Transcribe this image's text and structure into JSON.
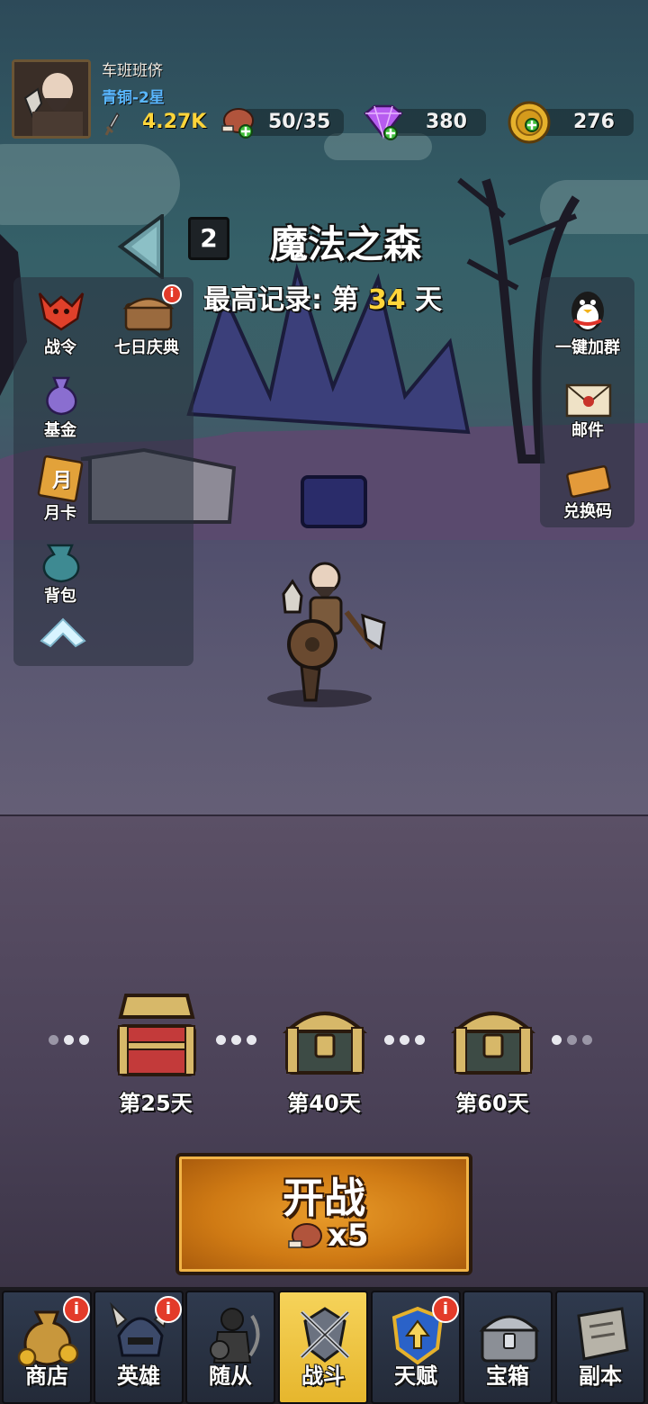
{
  "player": {
    "name": "车班班侪",
    "rank": "青铜-2星"
  },
  "resources": {
    "power": "4.27K",
    "stamina": "50/35",
    "gems": "380",
    "coins": "276"
  },
  "level": {
    "number": "2",
    "name": "魔法之森",
    "record_prefix": "最高记录: 第",
    "record_day": "34",
    "record_suffix": "天"
  },
  "left_menu": [
    {
      "label": "战令",
      "icon": "battle-pass-icon",
      "badge": ""
    },
    {
      "label": "七日庆典",
      "icon": "seven-day-chest-icon",
      "badge": "i"
    },
    {
      "label": "基金",
      "icon": "fund-bag-icon",
      "badge": ""
    },
    {
      "label": "月卡",
      "icon": "month-card-icon",
      "badge": ""
    },
    {
      "label": "背包",
      "icon": "backpack-icon",
      "badge": ""
    }
  ],
  "right_menu": [
    {
      "label": "一键加群",
      "icon": "qq-penguin-icon"
    },
    {
      "label": "邮件",
      "icon": "mail-icon"
    },
    {
      "label": "兑换码",
      "icon": "redeem-ticket-icon"
    }
  ],
  "month_card_glyph": "月",
  "milestones": [
    {
      "label": "第25天",
      "state": "open"
    },
    {
      "label": "第40天",
      "state": "locked"
    },
    {
      "label": "第60天",
      "state": "locked"
    }
  ],
  "battle": {
    "title": "开战",
    "cost": "x5"
  },
  "nav": [
    {
      "label": "商店",
      "icon": "shop-icon",
      "badge": "i",
      "active": false
    },
    {
      "label": "英雄",
      "icon": "hero-icon",
      "badge": "i",
      "active": false
    },
    {
      "label": "随从",
      "icon": "follower-icon",
      "badge": "",
      "active": false
    },
    {
      "label": "战斗",
      "icon": "battle-icon",
      "badge": "",
      "active": true
    },
    {
      "label": "天赋",
      "icon": "talent-icon",
      "badge": "i",
      "active": false
    },
    {
      "label": "宝箱",
      "icon": "chest-icon",
      "badge": "",
      "active": false
    },
    {
      "label": "副本",
      "icon": "dungeon-scroll-icon",
      "badge": "",
      "active": false
    }
  ],
  "colors": {
    "rank": "#59b7ff",
    "record_highlight": "#ffd53a",
    "active_tab": "#f6d35a",
    "battle_button": "#cf7a14",
    "badge": "#e33b2a"
  }
}
